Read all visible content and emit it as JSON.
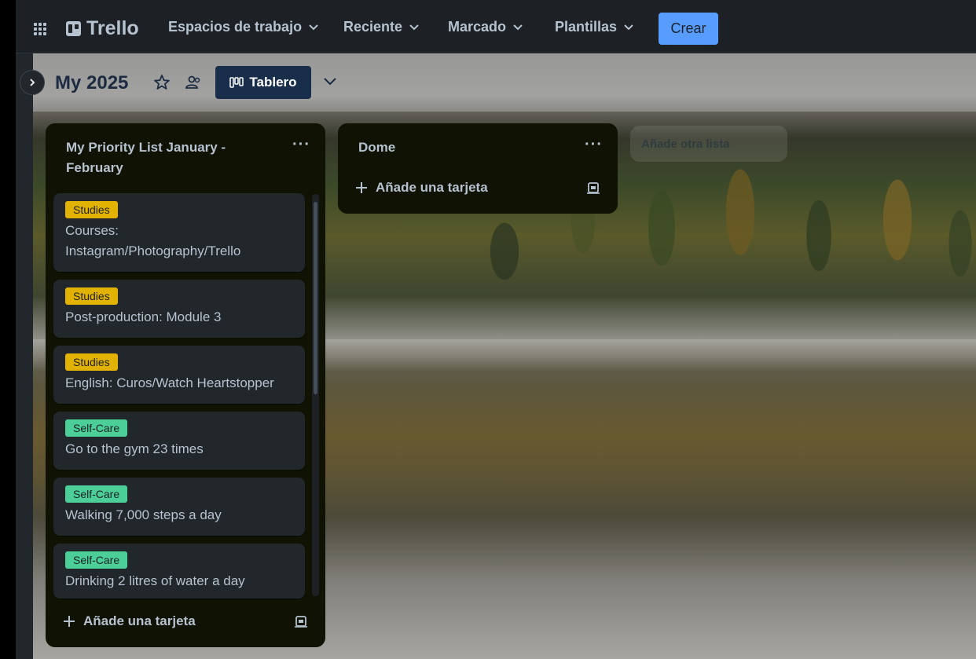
{
  "app": {
    "name": "Trello",
    "accent_color": "#579dff"
  },
  "topnav": {
    "menus": [
      {
        "label": "Espacios de trabajo"
      },
      {
        "label": "Reciente"
      },
      {
        "label": "Marcado"
      },
      {
        "label": "Plantillas"
      }
    ],
    "create_label": "Crear"
  },
  "board": {
    "title": "My 2025",
    "view_label": "Tablero",
    "background": "mountain lake with autumn forest"
  },
  "lists": [
    {
      "title": "My Priority List January - February",
      "cards": [
        {
          "label": "Studies",
          "label_color": "#e2b203",
          "text": "Courses: Instagram/Photography/Trello"
        },
        {
          "label": "Studies",
          "label_color": "#e2b203",
          "text": "Post-production: Module 3"
        },
        {
          "label": "Studies",
          "label_color": "#e2b203",
          "text": "English: Curos/Watch Heartstopper"
        },
        {
          "label": "Self-Care",
          "label_color": "#4bce97",
          "text": "Go to the gym 23 times"
        },
        {
          "label": "Self-Care",
          "label_color": "#4bce97",
          "text": "Walking 7,000 steps a day"
        },
        {
          "label": "Self-Care",
          "label_color": "#4bce97",
          "text": "Drinking 2 litres of water a day"
        }
      ],
      "add_card_label": "Añade una tarjeta"
    },
    {
      "title": "Dome",
      "cards": [],
      "add_card_label": "Añade una tarjeta"
    }
  ],
  "add_list_label": "Añade otra lista"
}
